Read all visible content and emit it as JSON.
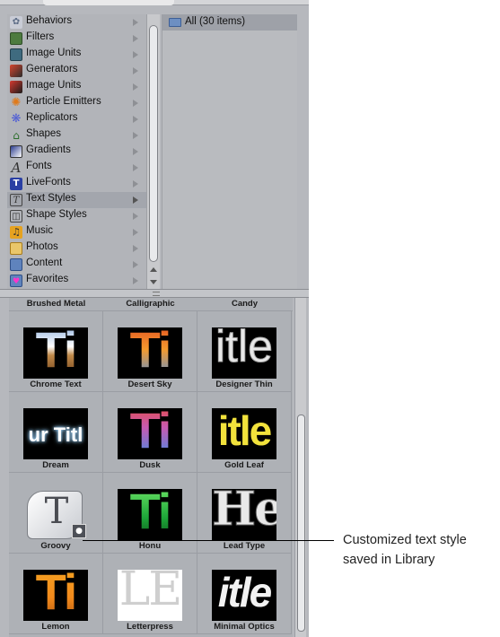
{
  "library": {
    "categories": [
      {
        "label": "Behaviors",
        "icon": "gear-icon"
      },
      {
        "label": "Filters",
        "icon": "filter-icon"
      },
      {
        "label": "Image Units",
        "icon": "image-unit-icon"
      },
      {
        "label": "Generators",
        "icon": "generator-icon"
      },
      {
        "label": "Image Units",
        "icon": "image-unit-icon"
      },
      {
        "label": "Particle Emitters",
        "icon": "particle-icon"
      },
      {
        "label": "Replicators",
        "icon": "replicator-icon"
      },
      {
        "label": "Shapes",
        "icon": "shape-icon"
      },
      {
        "label": "Gradients",
        "icon": "gradient-icon"
      },
      {
        "label": "Fonts",
        "icon": "font-icon"
      },
      {
        "label": "LiveFonts",
        "icon": "livefont-icon"
      },
      {
        "label": "Text Styles",
        "icon": "text-style-icon",
        "selected": true
      },
      {
        "label": "Shape Styles",
        "icon": "shape-style-icon"
      },
      {
        "label": "Music",
        "icon": "music-icon"
      },
      {
        "label": "Photos",
        "icon": "photos-icon"
      },
      {
        "label": "Content",
        "icon": "folder-icon"
      },
      {
        "label": "Favorites",
        "icon": "favorites-icon"
      }
    ],
    "folder": {
      "label": "All (30 items)"
    },
    "header_labels": [
      "Brushed Metal",
      "Calligraphic",
      "Candy"
    ],
    "styles": [
      {
        "label": "Chrome Text",
        "glyph": "Ti"
      },
      {
        "label": "Desert Sky",
        "glyph": "Ti"
      },
      {
        "label": "Designer Thin",
        "glyph": "itle"
      },
      {
        "label": "Dream",
        "glyph": "ur Titl"
      },
      {
        "label": "Dusk",
        "glyph": "Ti"
      },
      {
        "label": "Gold Leaf",
        "glyph": "itle"
      },
      {
        "label": "Groovy",
        "glyph": "T"
      },
      {
        "label": "Honu",
        "glyph": "Ti"
      },
      {
        "label": "Lead Type",
        "glyph": "He"
      },
      {
        "label": "Lemon",
        "glyph": "Ti"
      },
      {
        "label": "Letterpress",
        "glyph": "LE"
      },
      {
        "label": "Minimal Optics",
        "glyph": "itle"
      }
    ]
  },
  "callout": {
    "line1": "Customized text style",
    "line2": "saved in Library"
  }
}
